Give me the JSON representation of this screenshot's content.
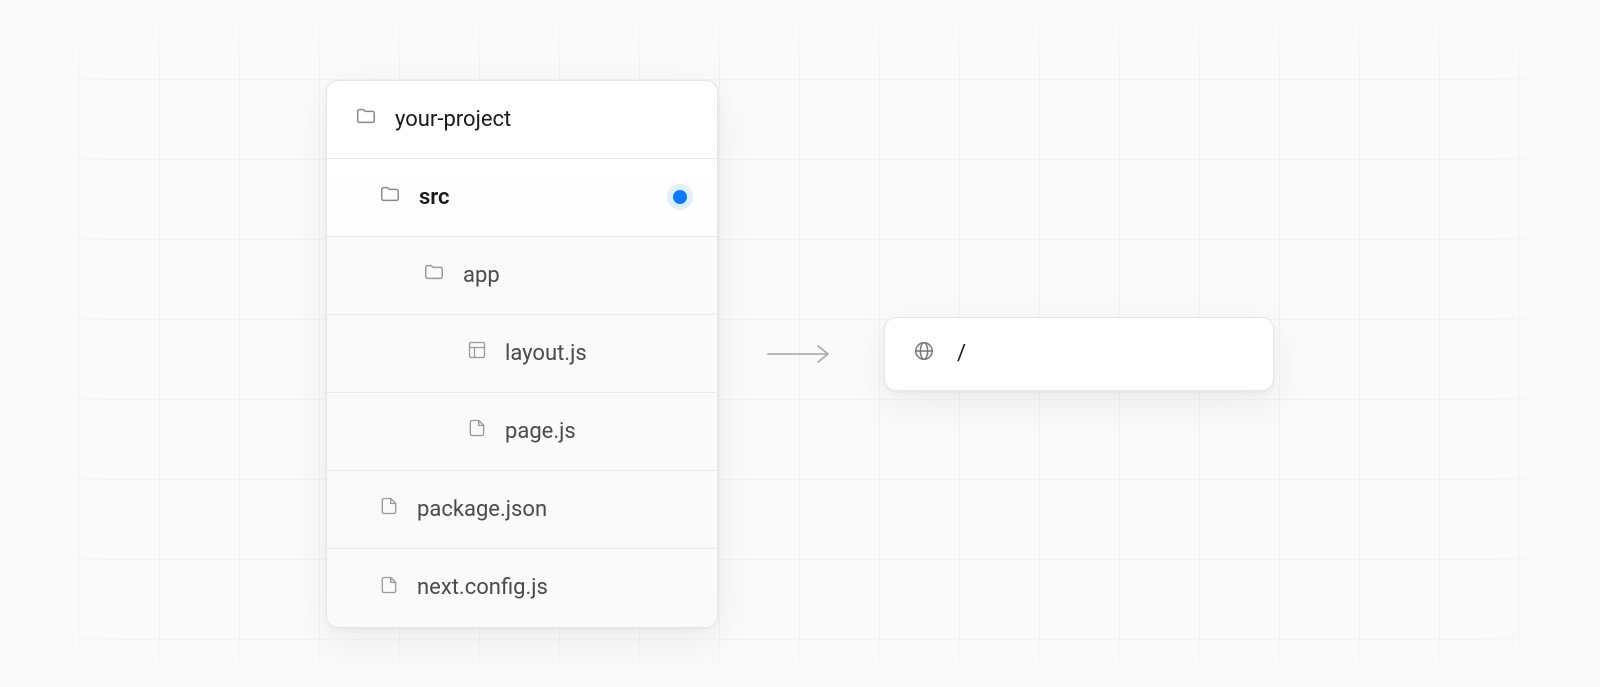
{
  "filetree": {
    "root": "your-project",
    "items": [
      {
        "label": "src",
        "icon": "folder",
        "highlight": true,
        "dot": true,
        "level": 1
      },
      {
        "label": "app",
        "icon": "folder",
        "level": 2,
        "faded": true
      },
      {
        "label": "layout.js",
        "icon": "layout",
        "level": 3,
        "faded": true
      },
      {
        "label": "page.js",
        "icon": "file",
        "level": 3,
        "faded": true
      },
      {
        "label": "package.json",
        "icon": "file",
        "level": 1,
        "faded": true
      },
      {
        "label": "next.config.js",
        "icon": "file",
        "level": 1,
        "faded": true
      }
    ]
  },
  "route": {
    "path": "/"
  },
  "colors": {
    "accent": "#0a7cff",
    "border": "#e5e5e5",
    "grid": "#ececec",
    "bg": "#fafafa"
  }
}
